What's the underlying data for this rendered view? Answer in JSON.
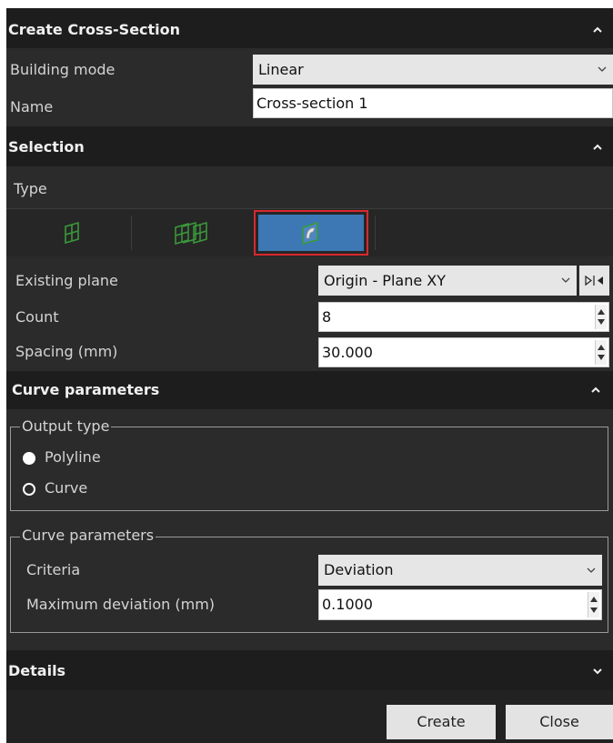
{
  "panel": {
    "title": "Create Cross-Section",
    "building_mode_label": "Building mode",
    "building_mode_value": "Linear",
    "name_label": "Name",
    "name_value": "Cross-section 1"
  },
  "selection": {
    "title": "Selection",
    "type_label": "Type",
    "type_buttons": [
      "single-plane-icon",
      "multiple-planes-icon",
      "curve-plane-icon"
    ],
    "selected_type_index": 2,
    "existing_plane_label": "Existing plane",
    "existing_plane_value": "Origin - Plane XY",
    "count_label": "Count",
    "count_value": "8",
    "spacing_label": "Spacing (mm)",
    "spacing_value": "30.000"
  },
  "curve_parameters": {
    "title": "Curve parameters",
    "output_type_legend": "Output type",
    "options": [
      "Polyline",
      "Curve"
    ],
    "selected_option": "Polyline",
    "group_legend": "Curve parameters",
    "criteria_label": "Criteria",
    "criteria_value": "Deviation",
    "max_dev_label": "Maximum deviation (mm)",
    "max_dev_value": "0.1000"
  },
  "details": {
    "title": "Details"
  },
  "footer": {
    "create_label": "Create",
    "close_label": "Close"
  },
  "colors": {
    "highlight_border": "#d9282f",
    "selected_fill": "#3d78b5",
    "icon_green": "#3a9a3a"
  }
}
